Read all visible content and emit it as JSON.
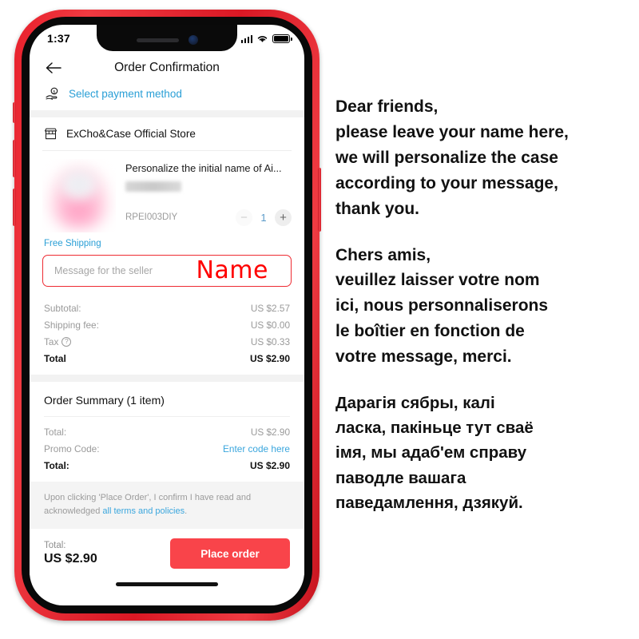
{
  "phone": {
    "status_bar": {
      "time": "1:37",
      "icons": [
        "cellular-signal-icon",
        "wifi-icon",
        "battery-icon"
      ]
    },
    "header": {
      "back_icon": "back-arrow-icon",
      "title": "Order Confirmation"
    },
    "payment": {
      "icon": "money-in-hand-icon",
      "label": "Select payment method"
    },
    "store": {
      "icon": "storefront-icon",
      "name": "ExCho&Case Official Store"
    },
    "product": {
      "title": "Personalize the initial name of Ai...",
      "variant": "",
      "sku": "RPEI003DIY",
      "qty_minus": "−",
      "qty_value": "1",
      "qty_plus": "+",
      "shipping_badge": "Free Shipping"
    },
    "message_field": {
      "placeholder": "Message for the seller",
      "value": "",
      "annotation": "Name",
      "annotation_color": "#ff0000",
      "border_color": "#ee2b32"
    },
    "price_lines": [
      {
        "label": "Subtotal:",
        "value": "US $2.57",
        "bold": false,
        "help": false
      },
      {
        "label": "Shipping fee:",
        "value": "US $0.00",
        "bold": false,
        "help": false
      },
      {
        "label": "Tax",
        "value": "US $0.33",
        "bold": false,
        "help": true
      },
      {
        "label": "Total",
        "value": "US $2.90",
        "bold": true,
        "help": false
      }
    ],
    "order_summary": {
      "title": "Order Summary (1 item)",
      "rows": [
        {
          "label": "Total:",
          "value": "US $2.90",
          "bold": false,
          "link": false
        },
        {
          "label": "Promo Code:",
          "value": "Enter code here",
          "bold": false,
          "link": true
        },
        {
          "label": "Total:",
          "value": "US $2.90",
          "bold": true,
          "link": false
        }
      ]
    },
    "terms": {
      "prefix": "Upon clicking 'Place Order', I confirm I have read and acknowledged ",
      "link": "all terms and policies",
      "suffix": "."
    },
    "checkout": {
      "total_label": "Total:",
      "total_amount": "US $2.90",
      "button_label": "Place order",
      "button_color": "#f9444a"
    }
  },
  "notice": {
    "paragraphs": [
      "Dear friends,\nplease leave your name here,\nwe will personalize the case\naccording to your message,\nthank you.",
      "Chers amis,\nveuillez laisser votre nom\nici, nous personnaliserons\nle boîtier en fonction de\nvotre message, merci.",
      "Дарагія сябры, калі\nласка, пакіньце тут сваё\nімя, мы адаб'ем справу\nпаводле вашага\nпаведамлення, дзякуй."
    ]
  }
}
